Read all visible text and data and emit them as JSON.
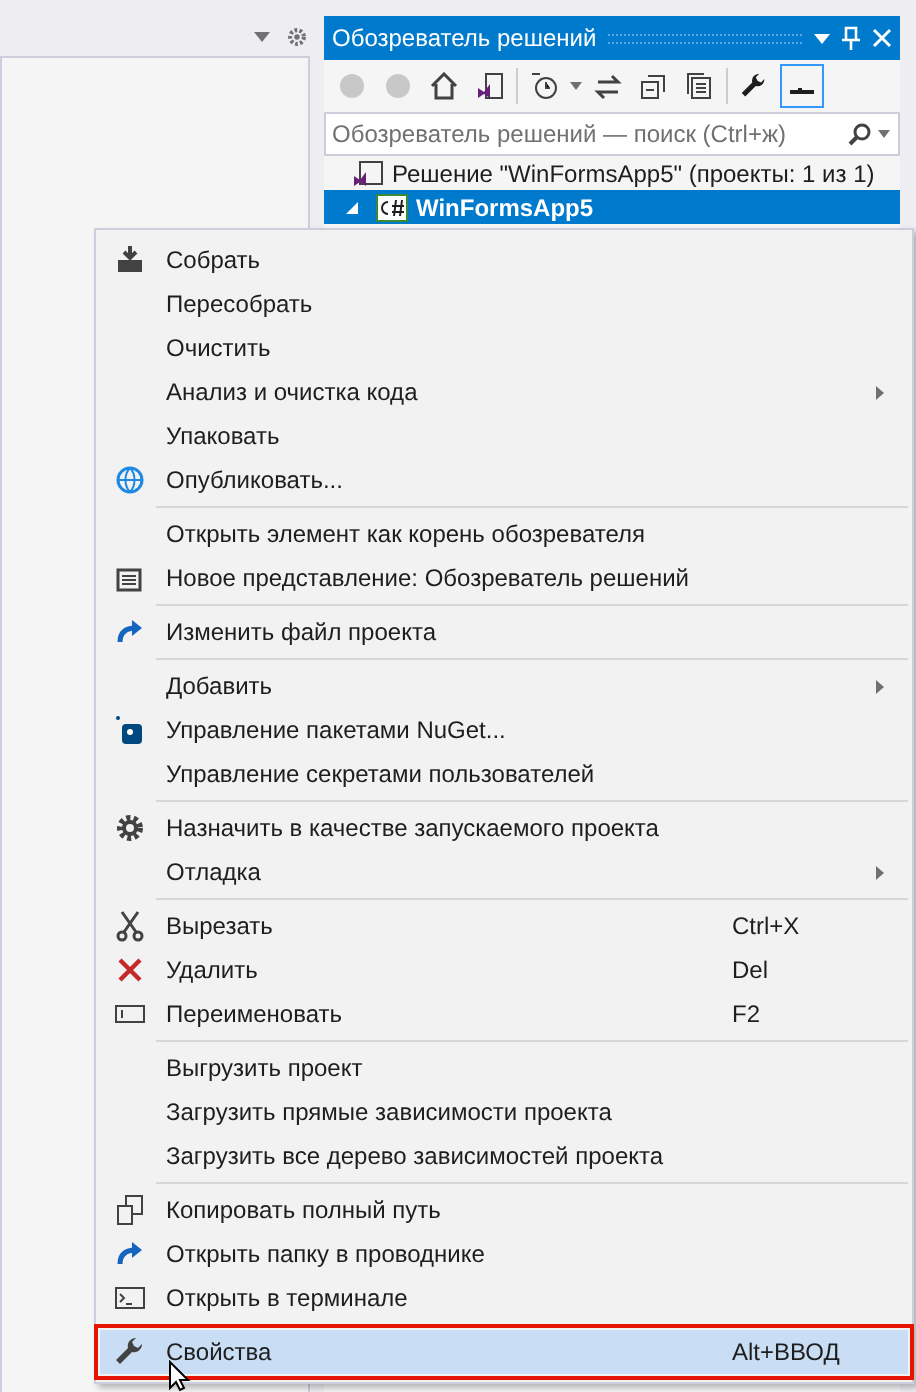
{
  "panel": {
    "title": "Обозреватель решений",
    "search": {
      "placeholder": "Обозреватель решений — поиск (Ctrl+ж)"
    },
    "tree": [
      {
        "label": "Решение \"WinFormsApp5\" (проекты: 1 из 1)",
        "selected": false,
        "kind": "solution"
      },
      {
        "label": "WinFormsApp5",
        "selected": true,
        "expanded": true,
        "kind": "project"
      }
    ]
  },
  "menu": [
    {
      "kind": "item",
      "label": "Собрать",
      "selected": false
    },
    {
      "kind": "item",
      "label": "Пересобрать",
      "selected": false
    },
    {
      "kind": "item",
      "label": "Очистить",
      "selected": false
    },
    {
      "kind": "item",
      "label": "Анализ и очистка кода",
      "submenu": true,
      "selected": false
    },
    {
      "kind": "item",
      "label": "Упаковать",
      "selected": false
    },
    {
      "kind": "item",
      "label": "Опубликовать...",
      "selected": false
    },
    {
      "kind": "separator"
    },
    {
      "kind": "item",
      "label": "Открыть элемент как корень обозревателя",
      "selected": false
    },
    {
      "kind": "item",
      "label": "Новое представление: Обозреватель решений",
      "selected": false
    },
    {
      "kind": "separator"
    },
    {
      "kind": "item",
      "label": "Изменить файл проекта",
      "selected": false
    },
    {
      "kind": "separator"
    },
    {
      "kind": "item",
      "label": "Добавить",
      "submenu": true,
      "selected": false
    },
    {
      "kind": "item",
      "label": "Управление пакетами NuGet...",
      "selected": false
    },
    {
      "kind": "item",
      "label": "Управление секретами пользователей",
      "selected": false
    },
    {
      "kind": "separator"
    },
    {
      "kind": "item",
      "label": "Назначить в качестве запускаемого проекта",
      "selected": false
    },
    {
      "kind": "item",
      "label": "Отладка",
      "submenu": true,
      "selected": false
    },
    {
      "kind": "separator"
    },
    {
      "kind": "item",
      "label": "Вырезать",
      "shortcut": "Ctrl+X",
      "selected": false
    },
    {
      "kind": "item",
      "label": "Удалить",
      "shortcut": "Del",
      "selected": false
    },
    {
      "kind": "item",
      "label": "Переименовать",
      "shortcut": "F2",
      "selected": false
    },
    {
      "kind": "separator"
    },
    {
      "kind": "item",
      "label": "Выгрузить проект",
      "selected": false
    },
    {
      "kind": "item",
      "label": "Загрузить прямые зависимости проекта",
      "selected": false
    },
    {
      "kind": "item",
      "label": "Загрузить все дерево зависимостей проекта",
      "selected": false
    },
    {
      "kind": "separator"
    },
    {
      "kind": "item",
      "label": "Копировать полный путь",
      "selected": false
    },
    {
      "kind": "item",
      "label": "Открыть папку в проводнике",
      "selected": false
    },
    {
      "kind": "item",
      "label": "Открыть в терминале",
      "selected": false
    },
    {
      "kind": "separator"
    },
    {
      "kind": "item",
      "label": "Свойства",
      "shortcut": "Alt+ВВОД",
      "selected": true
    }
  ]
}
